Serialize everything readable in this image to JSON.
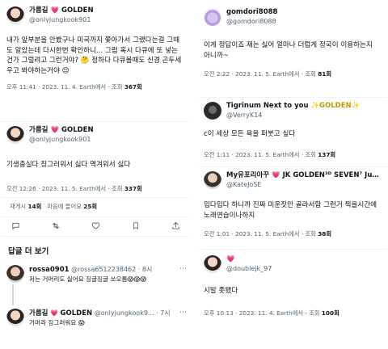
{
  "left": {
    "tweet1": {
      "display_name": "가름길",
      "heart_glyph": "💗",
      "name_suffix": "GOLDEN",
      "handle": "@onlyjungkook901",
      "text": "내가 앞부분을 안봤구나 미국까지 쫓아가서 그랬다는걸 그때도 알았는데 다시한번 확인하니... 그럼 혹시 다큐에 또 넣는건가 그럴려고 그런거야? 🤔 정하다 다큐볼때도 신경 곤두세우고 봐야하는거야 😌",
      "time": "오후 11:41 · 2023. 11. 4. Earth에서 · 조회 ",
      "views": "367회"
    },
    "tweet2": {
      "display_name": "가름길",
      "heart_glyph": "💗",
      "name_suffix": "GOLDEN",
      "handle": "@onlyjungkook901",
      "text": "기생충실다 징그러워서 싫다 역겨워서 싫다",
      "time": "오전 12:26 · 2023. 11. 5. Earth에서 · 조회 ",
      "views": "337회",
      "stats_prefix": "재게시",
      "retweets": "14회",
      "likes_prefix": "마음에 들어요",
      "likes": "25회"
    },
    "replies_header": "답글 더 보기",
    "reply1": {
      "display_name": "rossa0901",
      "handle": "@rossa6512238462 · 8시",
      "text": "저는 거머리도 싫어요 징글징글 쏘오름😱😱😱"
    },
    "reply2": {
      "display_name": "가름길",
      "heart_glyph": "💗",
      "name_suffix": "GOLDEN",
      "handle": "@onlyjungkook9... · 7시",
      "text": "거머리 징그러워요 😱"
    }
  },
  "right": {
    "tweet1": {
      "display_name": "gomdori8088",
      "handle": "@gomdori8088",
      "text": "이게 정답이죠 재는 싫어 얼마나 더럽게 정국이 이용하는지 아니까~",
      "time": "오전 2:22 · 2023. 11. 5. Earth에서 · 조회 ",
      "views": "81회"
    },
    "tweet2": {
      "display_name": "Tigrinum Next to you",
      "name_suffix": "✨GOLDEN✨",
      "handle": "@VerryK14",
      "text": "c이 세상 모든 욕을 퍼붓고 싶다",
      "time": "오전 1:11 · 2023. 11. 5. Earth에서 · 조회 ",
      "views": "137회"
    },
    "tweet3": {
      "display_name": "My유포리아꾸",
      "name_suffix": "💗 JK GOLDEN³ᴰ SEVEN⁷ Jun...",
      "handle": "@KateJoSE",
      "text": "밉다밉다 하니까 진짜 미운짓만 골라서함 그런거 찍을시간에 노래연습이나하지",
      "time": "오전 1:01 · 2023. 11. 5. Earth에서 · 조회 ",
      "views": "38회"
    },
    "tweet4": {
      "display_name": "💗",
      "handle": "@doublejk_97",
      "text": "시발 좃됐다",
      "time": "오후 10:13 · 2023. 11. 4. Earth에서 · 조회 ",
      "views": "100회"
    }
  },
  "icons": {
    "more": "⋯",
    "reply": "💬",
    "retweet": "🔁",
    "like": "♡",
    "bookmark": "🔖",
    "share": "⤴"
  }
}
